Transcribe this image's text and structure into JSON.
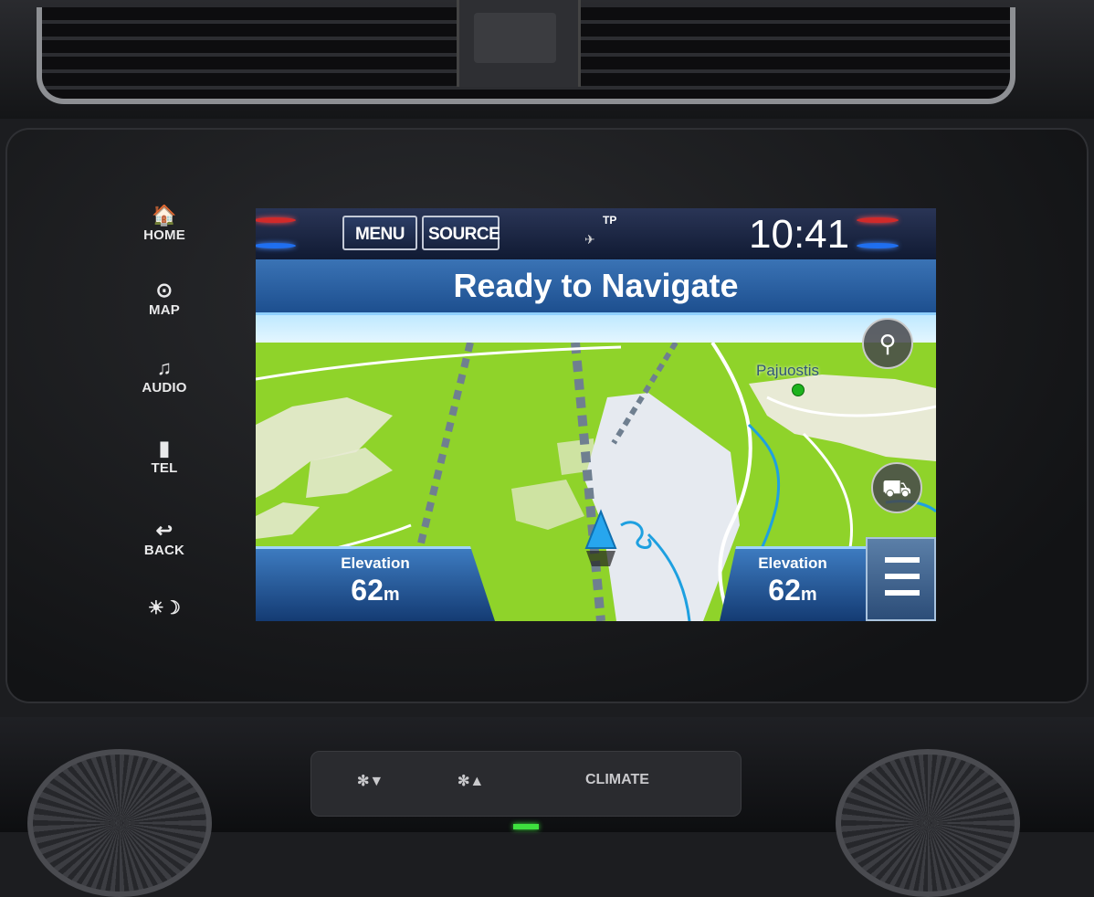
{
  "side_buttons": [
    {
      "label": "HOME",
      "icon": "home-icon",
      "glyph": "🏠"
    },
    {
      "label": "MAP",
      "icon": "map-icon",
      "glyph": "⊙"
    },
    {
      "label": "AUDIO",
      "icon": "music-note-icon",
      "glyph": "♫"
    },
    {
      "label": "TEL",
      "icon": "phone-icon",
      "glyph": "▮"
    },
    {
      "label": "BACK",
      "icon": "back-arrow-icon",
      "glyph": "↩"
    }
  ],
  "daynight": {
    "glyph": "☀☽",
    "icon": "day-night-icon"
  },
  "status_bar": {
    "menu_label": "MENU",
    "source_label": "SOURCE",
    "tp_label": "TP",
    "gps_icon": "satellite-icon",
    "clock": "10:41"
  },
  "title": "Ready to Navigate",
  "map": {
    "place_label": "Pajuostis",
    "search_icon": "search-icon",
    "traffic_icon": "traffic-icon",
    "vehicle_icon": "vehicle-arrow-icon"
  },
  "elevation_left": {
    "label": "Elevation",
    "value": "62",
    "unit": "m"
  },
  "elevation_right": {
    "label": "Elevation",
    "value": "62",
    "unit": "m"
  },
  "menu_icon": "hamburger-menu-icon",
  "climate": {
    "fan_down_label": "✻▼",
    "fan_up_label": "✻▲",
    "climate_label": "CLIMATE"
  },
  "colors": {
    "map_green": "#8fd32a",
    "title_blue": "#2a62a5",
    "status_bg": "#101a33",
    "road_blue": "#1ea0e0"
  }
}
